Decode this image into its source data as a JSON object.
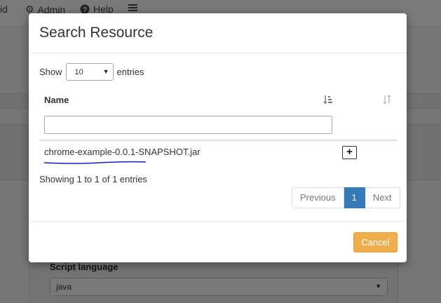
{
  "background": {
    "nav": [
      {
        "label": "id",
        "icon": ""
      },
      {
        "label": "Admin",
        "icon": "gear-icon"
      },
      {
        "label": "Help",
        "icon": "question-circle-icon"
      }
    ],
    "menu_icon": "hamburger-menu-icon",
    "script_language_label": "Script language",
    "script_language_value": "java"
  },
  "modal": {
    "title": "Search Resource",
    "show_label": "Show",
    "page_length": "10",
    "entries_label": "entries",
    "column_header": "Name",
    "rows": [
      {
        "name": "chrome-example-0.0.1-SNAPSHOT.jar"
      }
    ],
    "info": "Showing 1 to 1 of 1 entries",
    "pagination": {
      "previous": "Previous",
      "current": "1",
      "next": "Next"
    },
    "cancel_label": "Cancel"
  },
  "colors": {
    "primary": "#337ab7",
    "warning": "#f0ad4e",
    "annotation_underline": "#1a1ad6"
  }
}
